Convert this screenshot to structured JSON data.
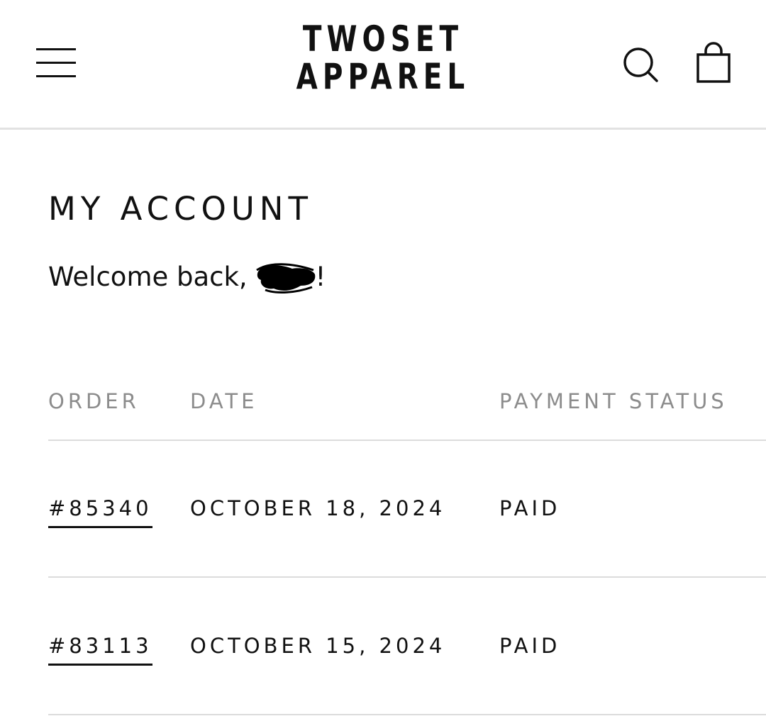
{
  "header": {
    "logo_line1": "TWOSET",
    "logo_line2": "APPAREL",
    "icons": [
      "hamburger-menu-icon",
      "search-icon",
      "shopping-bag-icon"
    ]
  },
  "account": {
    "title": "MY ACCOUNT",
    "welcome_prefix": "Welcome back,",
    "welcome_suffix": "!"
  },
  "orders": {
    "columns": {
      "order": "ORDER",
      "date": "DATE",
      "payment_status": "PAYMENT STATUS"
    },
    "rows": [
      {
        "order": "#85340",
        "date": "OCTOBER 18, 2024",
        "payment_status": "PAID"
      },
      {
        "order": "#83113",
        "date": "OCTOBER 15, 2024",
        "payment_status": "PAID"
      }
    ]
  },
  "colors": {
    "text": "#111111",
    "muted": "#8c8c8c",
    "divider": "#dcdcdc",
    "background": "#ffffff"
  }
}
